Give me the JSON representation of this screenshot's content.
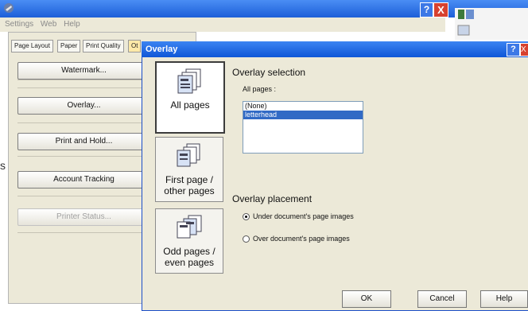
{
  "back_window": {
    "menu": [
      "Settings",
      "Web",
      "Help"
    ],
    "tabs": [
      "Page Layout",
      "Paper",
      "Print Quality",
      "Ot"
    ],
    "buttons": [
      {
        "label": "Watermark...",
        "enabled": true
      },
      {
        "label": "Overlay...",
        "enabled": true
      },
      {
        "label": "Print and Hold...",
        "enabled": true
      },
      {
        "label": "Account Tracking",
        "enabled": true
      },
      {
        "label": "Printer Status...",
        "enabled": false
      }
    ],
    "help_glyph": "?",
    "close_glyph": "X",
    "edge_char": "s"
  },
  "dialog": {
    "title": "Overlay",
    "help_glyph": "?",
    "close_glyph": "X",
    "page_options": [
      {
        "label": "All pages",
        "icon": "pages-icon",
        "selected": true
      },
      {
        "label": "First page / other pages",
        "icon": "pages-icon",
        "selected": false
      },
      {
        "label": "Odd pages / even pages",
        "icon": "pages-icon",
        "selected": false
      }
    ],
    "overlay_selection": {
      "heading": "Overlay selection",
      "sublabel": "All pages :",
      "items": [
        "(None)",
        "letterhead"
      ],
      "selected": "letterhead"
    },
    "overlay_placement": {
      "heading": "Overlay placement",
      "options": [
        {
          "label": "Under document's page images",
          "checked": true
        },
        {
          "label": "Over document's page images",
          "checked": false
        }
      ]
    },
    "buttons": {
      "ok": "OK",
      "cancel": "Cancel",
      "help": "Help"
    }
  },
  "colors": {
    "titlebar": "#1d5fd8",
    "selection": "#316ac5",
    "dialog_bg": "#ece9d8"
  }
}
